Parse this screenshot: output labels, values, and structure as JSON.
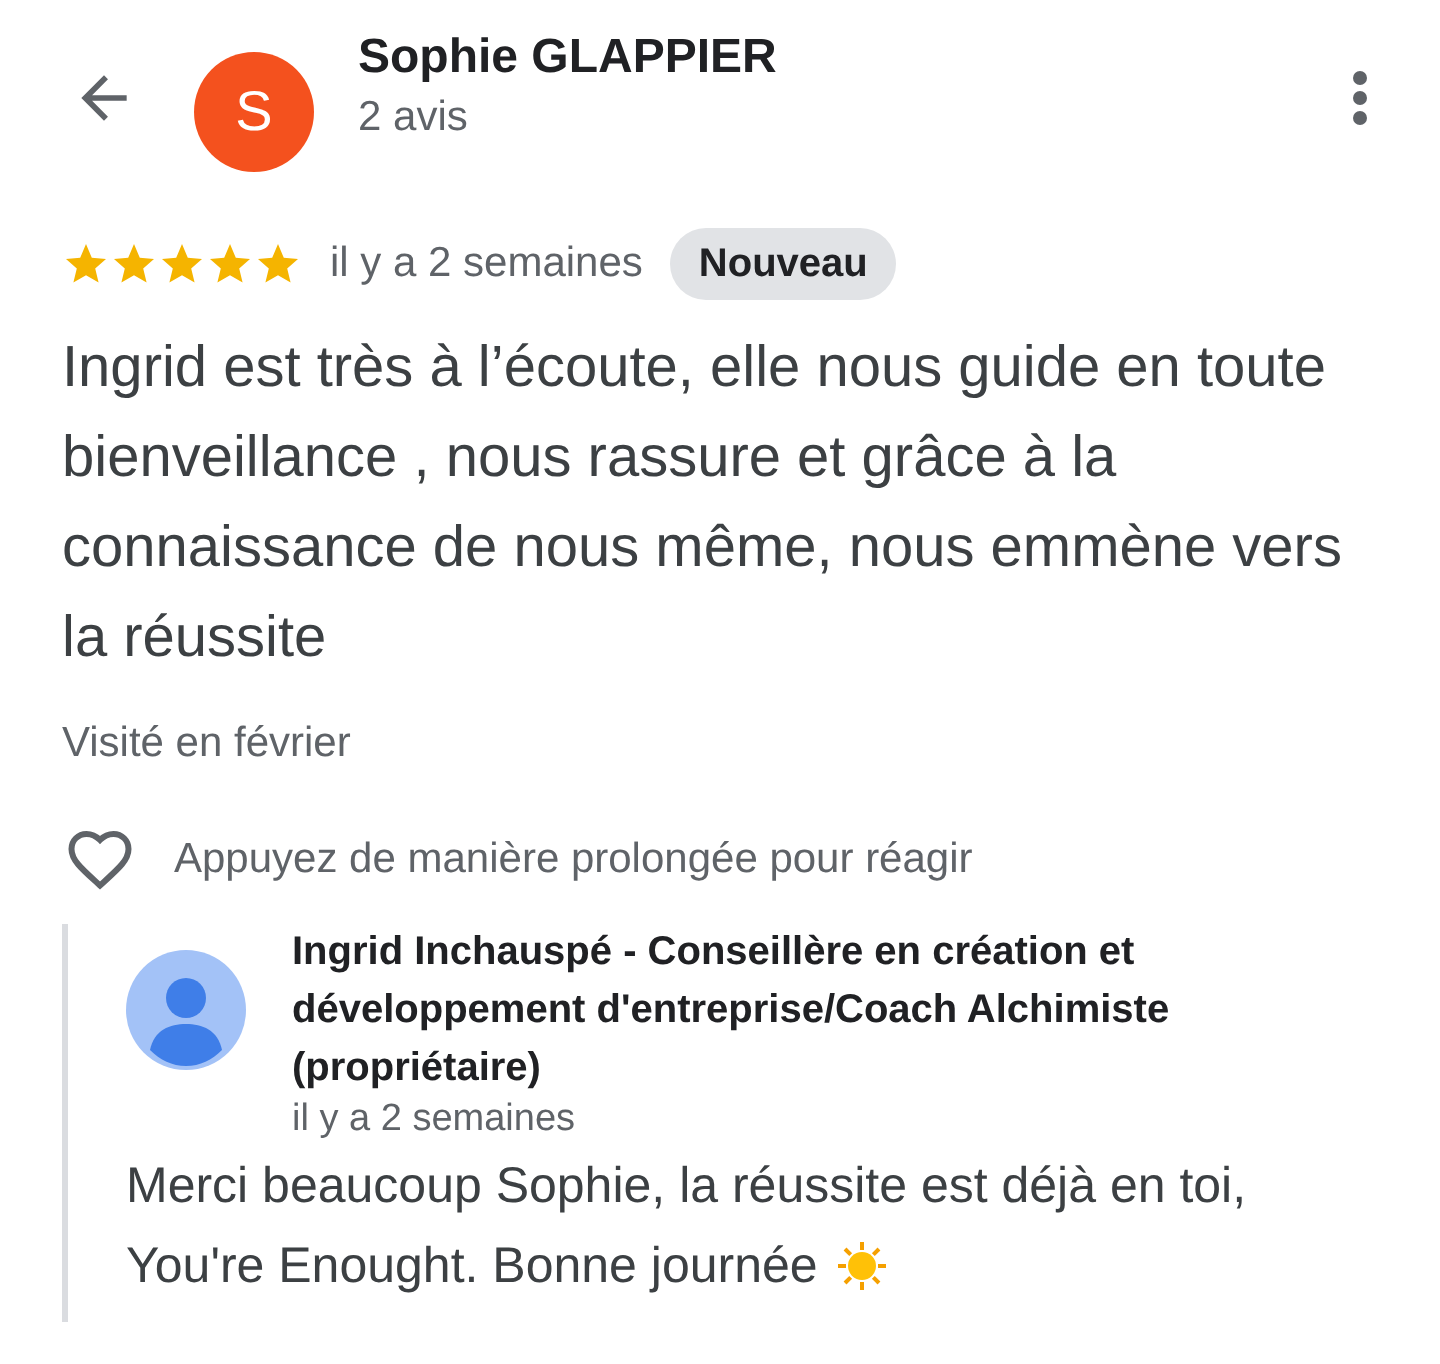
{
  "reviewer": {
    "initial": "S",
    "name": "Sophie GLAPPIER",
    "review_count": "2 avis"
  },
  "review": {
    "stars": 5,
    "time": "il y a 2 semaines",
    "badge": "Nouveau",
    "text": "Ingrid est très à l’écoute, elle nous guide en toute bienveillance , nous rassure et grâce à la connaissance de nous même, nous emmène vers la réussite",
    "visit": "Visité en février"
  },
  "reaction": {
    "label": "Appuyez de manière prolongée pour réagir"
  },
  "owner_reply": {
    "name": "Ingrid Inchauspé - Conseillère en création et développement d'entreprise/Coach Alchimiste (propriétaire)",
    "time": "il y a 2 semaines",
    "text_lines": [
      "Merci beaucoup Sophie, la réussite est déjà en toi,",
      "You're Enought. Bonne journée"
    ]
  }
}
